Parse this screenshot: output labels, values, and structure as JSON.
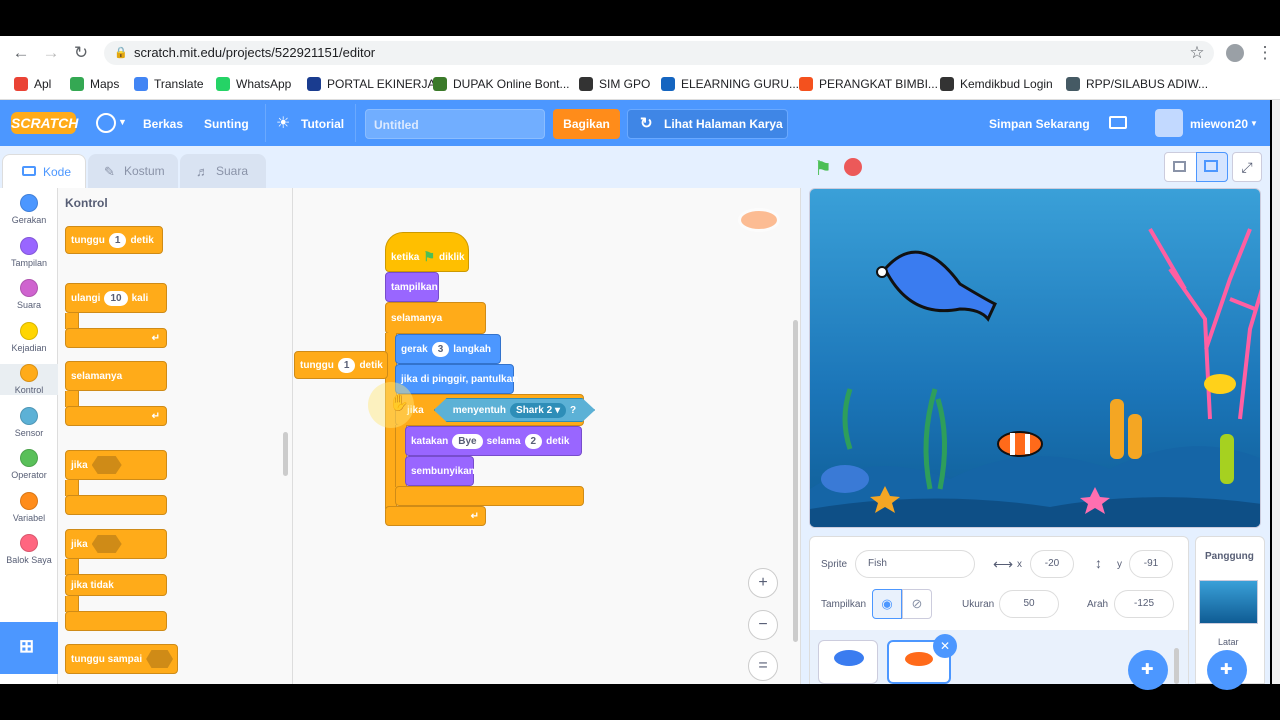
{
  "browser": {
    "url": "scratch.mit.edu/projects/522921151/editor"
  },
  "bookmarks": [
    {
      "label": "Apl",
      "color": "#ea4335"
    },
    {
      "label": "Maps",
      "color": "#34a853"
    },
    {
      "label": "Translate",
      "color": "#4285f4"
    },
    {
      "label": "WhatsApp",
      "color": "#25d366"
    },
    {
      "label": "PORTAL EKINERJA",
      "color": "#1a3c8f"
    },
    {
      "label": "DUPAK Online Bont...",
      "color": "#3b7a2a"
    },
    {
      "label": "SIM GPO",
      "color": "#333333"
    },
    {
      "label": "ELEARNING GURU...",
      "color": "#1565c0"
    },
    {
      "label": "PERANGKAT BIMBI...",
      "color": "#f4511e"
    },
    {
      "label": "Kemdikbud Login",
      "color": "#333333"
    },
    {
      "label": "RPP/SILABUS ADIW...",
      "color": "#455a64"
    }
  ],
  "menubar": {
    "logo": "SCRATCH",
    "file": "Berkas",
    "edit": "Sunting",
    "tutorial": "Tutorial",
    "title": "Untitled",
    "share": "Bagikan",
    "see_project": "Lihat Halaman Karya",
    "save_now": "Simpan Sekarang",
    "username": "miewon20"
  },
  "tabs": {
    "code": "Kode",
    "costume": "Kostum",
    "sound": "Suara"
  },
  "categories": [
    {
      "label": "Gerakan",
      "color": "#4c97ff"
    },
    {
      "label": "Tampilan",
      "color": "#9966ff"
    },
    {
      "label": "Suara",
      "color": "#cf63cf"
    },
    {
      "label": "Kejadian",
      "color": "#ffd500"
    },
    {
      "label": "Kontrol",
      "color": "#ffab19"
    },
    {
      "label": "Sensor",
      "color": "#5cb1d6"
    },
    {
      "label": "Operator",
      "color": "#59c059"
    },
    {
      "label": "Variabel",
      "color": "#ff8c1a"
    },
    {
      "label": "Balok Saya",
      "color": "#ff6680"
    }
  ],
  "flyout": {
    "heading": "Kontrol",
    "wait": "tunggu",
    "wait_val": "1",
    "wait_unit": "detik",
    "repeat": "ulangi",
    "repeat_val": "10",
    "repeat_unit": "kali",
    "forever": "selamanya",
    "if": "jika",
    "if2": "jika",
    "else": "jika tidak",
    "wait_until": "tunggu sampai"
  },
  "script": {
    "when_flag": "ketika",
    "clicked": "diklik",
    "show": "tampilkan",
    "forever": "selamanya",
    "move": "gerak",
    "move_val": "3",
    "move_unit": "langkah",
    "bounce": "jika di pinggir, pantulkan",
    "if": "jika",
    "touching": "menyentuh",
    "touching_target": "Shark 2",
    "q": "?",
    "say": "katakan",
    "say_val": "Bye",
    "for": "selama",
    "say_secs": "2",
    "secs": "detik",
    "hide": "sembunyikan",
    "loose_wait": "tunggu",
    "loose_wait_val": "1",
    "loose_wait_unit": "detik"
  },
  "sprite_info": {
    "sprite_label": "Sprite",
    "sprite_name": "Fish",
    "x_label": "x",
    "x": "-20",
    "y_label": "y",
    "y": "-91",
    "show_label": "Tampilkan",
    "size_label": "Ukuran",
    "size": "50",
    "dir_label": "Arah",
    "direction": "-125"
  },
  "stage_panel": {
    "label": "Panggung",
    "backdrop_label": "Latar"
  }
}
